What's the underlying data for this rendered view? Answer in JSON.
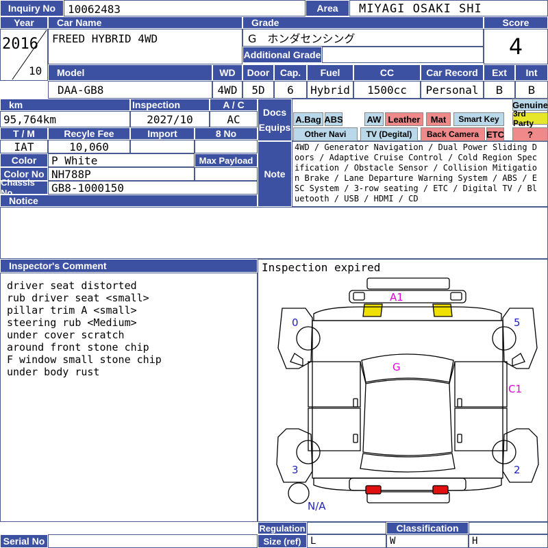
{
  "header": {
    "inquiry_no_label": "Inquiry No",
    "inquiry_no": "10062483",
    "area_label": "Area",
    "area": "MIYAGI OSAKI SHI"
  },
  "row1": {
    "year_label": "Year",
    "year": "2016",
    "month": "10",
    "car_name_label": "Car Name",
    "car_name": "FREED HYBRID 4WD",
    "grade_label": "Grade",
    "grade": "G　ホンダセンシング",
    "additional_grade_label": "Additional Grade",
    "additional_grade": "",
    "score_label": "Score",
    "score": "4"
  },
  "row2": {
    "model_label": "Model",
    "model": "DAA-GB8",
    "wd_label": "WD",
    "wd": "4WD",
    "door_label": "Door",
    "door": "5D",
    "cap_label": "Cap.",
    "cap": "6",
    "fuel_label": "Fuel",
    "fuel": "Hybrid",
    "cc_label": "CC",
    "cc": "1500cc",
    "car_record_label": "Car Record",
    "car_record": "Personal",
    "ext_label": "Ext",
    "ext": "B",
    "int_label": "Int",
    "int": "B"
  },
  "details": {
    "km_label": "km",
    "km": "95,764km",
    "inspection_label": "Inspection",
    "inspection": "2027/10",
    "ac_label": "A / C",
    "ac": "AC",
    "tm_label": "T / M",
    "tm": "IAT",
    "recycle_fee_label": "Recyle Fee",
    "recycle_fee": "10,060",
    "import_label": "Import",
    "import": "",
    "no8_label": "8 No",
    "no8": "",
    "color_label": "Color",
    "color": "P White",
    "max_payload_label": "Max Payload",
    "max_payload": "",
    "color_no_label": "Color No",
    "color_no": "NH788P",
    "chassis_no_label": "Chassis No",
    "chassis_no": "GB8-1000150",
    "notice_label": "Notice",
    "notice": ""
  },
  "equips": {
    "label": "Docs\nEquips",
    "tags": [
      {
        "label": "A.Bag",
        "bg": "#b9d9ea"
      },
      {
        "label": "ABS",
        "bg": "#b9d9ea"
      },
      {
        "label": "AW",
        "bg": "#b9d9ea"
      },
      {
        "label": "Leather",
        "bg": "#f08a8a"
      },
      {
        "label": "Mat",
        "bg": "#f08a8a"
      },
      {
        "label": "Smart Key",
        "bg": "#b9d9ea"
      },
      {
        "label": "Genuine",
        "bg": "#b9d9ea"
      },
      {
        "label": "3rd Party",
        "bg": "#e6e62a"
      },
      {
        "label": "Other Navi",
        "bg": "#b9d9ea"
      },
      {
        "label": "TV (Degital)",
        "bg": "#b9d9ea"
      },
      {
        "label": "Back Camera",
        "bg": "#f08a8a"
      },
      {
        "label": "ETC",
        "bg": "#f08a8a"
      },
      {
        "label": "?",
        "bg": "#f08a8a"
      }
    ]
  },
  "note": {
    "label": "Note",
    "text": "4WD / Generator Navigation / Dual Power Sliding Doors / Adaptive Cruise Control / Cold Region Specification / Obstacle Sensor / Collision Mitigation Brake / Lane Departure Warning System / ABS / ESC System / 3-row seating / ETC / Digital TV / Bluetooth / USB / HDMI / CD"
  },
  "inspector": {
    "label": "Inspector's Comment",
    "lines": [
      "driver seat distorted",
      "rub driver seat <small>",
      "pillar trim A <small>",
      "steering rub <Medium>",
      "under cover scratch",
      "around front stone chip",
      "F window small stone chip",
      "under body rust"
    ]
  },
  "map": {
    "title": "Inspection expired",
    "marks": {
      "a1": "A1",
      "g": "G",
      "c1": "C1"
    },
    "numbers": {
      "n0": "0",
      "n5": "5",
      "n3": "3",
      "n2": "2",
      "na": "N/A"
    },
    "colors": {
      "mark": "#e000e0",
      "number": "#2020c0",
      "yellow": "#f0e000",
      "red": "#e01010"
    }
  },
  "footer": {
    "serial_label": "Serial No",
    "serial": "",
    "regulation_label": "Regulation",
    "size_label": "Size (ref)",
    "classification_label": "Classification",
    "l_label": "L",
    "w_label": "W",
    "h_label": "H"
  }
}
